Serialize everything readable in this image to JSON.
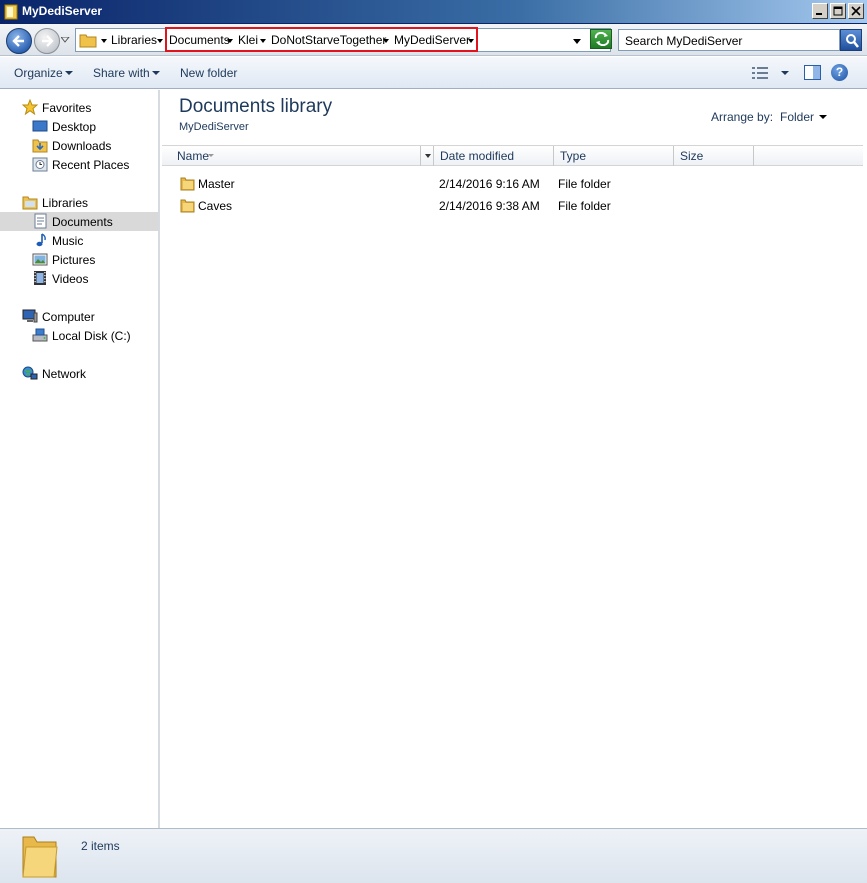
{
  "window": {
    "title": "MyDediServer"
  },
  "address": {
    "crumbs": [
      "Libraries",
      "Documents",
      "Klei",
      "DoNotStarveTogether",
      "MyDediServer"
    ],
    "highlight_color": "#e0141c"
  },
  "search": {
    "placeholder": "Search MyDediServer"
  },
  "toolbar": {
    "organize": "Organize",
    "share_with": "Share with",
    "new_folder": "New folder"
  },
  "nav": {
    "favorites": {
      "label": "Favorites",
      "items": [
        "Desktop",
        "Downloads",
        "Recent Places"
      ]
    },
    "libraries": {
      "label": "Libraries",
      "items": [
        "Documents",
        "Music",
        "Pictures",
        "Videos"
      ],
      "selected": "Documents"
    },
    "computer": {
      "label": "Computer",
      "items": [
        "Local Disk (C:)"
      ]
    },
    "network": {
      "label": "Network"
    }
  },
  "library": {
    "title": "Documents library",
    "subtitle": "MyDediServer",
    "arrange_label": "Arrange by:",
    "arrange_value": "Folder"
  },
  "columns": [
    "Name",
    "Date modified",
    "Type",
    "Size"
  ],
  "files": [
    {
      "name": "Master",
      "date": "2/14/2016 9:16 AM",
      "type": "File folder",
      "size": ""
    },
    {
      "name": "Caves",
      "date": "2/14/2016 9:38 AM",
      "type": "File folder",
      "size": ""
    }
  ],
  "status": {
    "count": "2 items"
  },
  "colors": {
    "title_gradient_start": "#0a246a",
    "folder": "#e8b84a",
    "selection": "#d9d9d9"
  }
}
